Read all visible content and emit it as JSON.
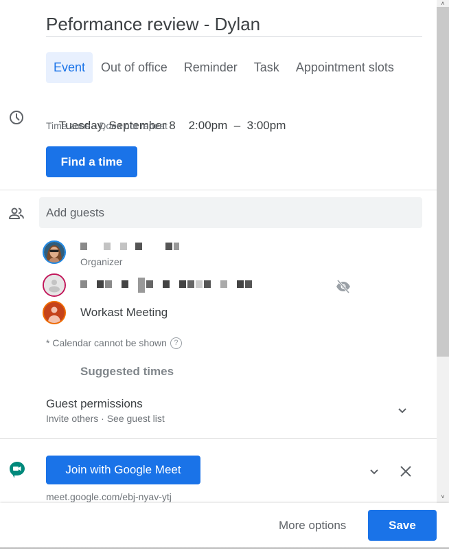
{
  "event": {
    "title": "Peformance review - Dylan"
  },
  "tabs": [
    {
      "label": "Event",
      "active": true
    },
    {
      "label": "Out of office",
      "active": false
    },
    {
      "label": "Reminder",
      "active": false
    },
    {
      "label": "Task",
      "active": false
    },
    {
      "label": "Appointment slots",
      "active": false
    }
  ],
  "datetime": {
    "date": "Tuesday, September 8",
    "start": "2:00pm",
    "separator": "–",
    "end": "3:00pm",
    "timezone_label": "Time zone",
    "dot": "·",
    "repeat_label": "Does not repeat",
    "find_time_label": "Find a time"
  },
  "guests": {
    "placeholder": "Add guests",
    "list": [
      {
        "name": "[redacted email]",
        "role": "Organizer",
        "avatar": "photo",
        "ring_color": "#1e88e5"
      },
      {
        "name": "[redacted]",
        "role": "",
        "avatar": "default-person",
        "ring_color": "#c2185b",
        "hidden_calendar": true
      },
      {
        "name": "Workast Meeting",
        "role": "",
        "avatar": "person",
        "ring_color": "#ef6c00"
      }
    ],
    "calendar_note": "* Calendar cannot be shown",
    "help_glyph": "?",
    "suggested_times_label": "Suggested times"
  },
  "permissions": {
    "title": "Guest permissions",
    "subtitle": "Invite others · See guest list"
  },
  "meet": {
    "join_label": "Join with Google Meet",
    "link": "meet.google.com/ebj-nyav-ytj"
  },
  "footer": {
    "more_options_label": "More options",
    "save_label": "Save"
  },
  "icons": {
    "clock": "clock-icon",
    "guests": "people-icon",
    "visibility_off": "eye-off-icon",
    "help": "help-circle-icon",
    "meet": "google-meet-icon",
    "chevron": "chevron-down-icon",
    "close": "close-icon"
  },
  "colors": {
    "primary": "#1a73e8",
    "tab_active_bg": "#e8f0fe",
    "text": "#3c4043",
    "text_secondary": "#70757a",
    "input_bg": "#f1f3f4",
    "meet_green": "#00897b"
  }
}
